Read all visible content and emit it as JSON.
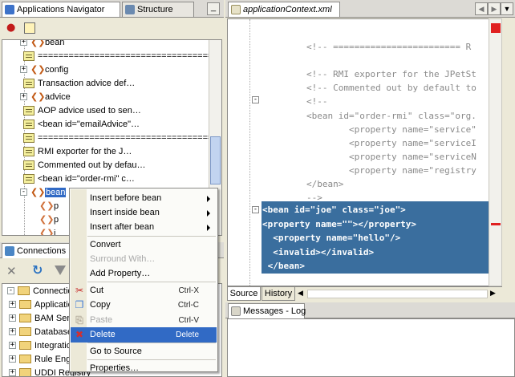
{
  "navigator": {
    "tab_applications": "Applications Navigator",
    "tab_structure": "Structure",
    "minimize": "_",
    "tree": [
      {
        "kind": "bean",
        "label": "bean",
        "expander": "+"
      },
      {
        "kind": "note",
        "label": "=====================================",
        "expander": ""
      },
      {
        "kind": "bean",
        "label": "config",
        "expander": "+"
      },
      {
        "kind": "note",
        "label": "Transaction advice def…",
        "expander": ""
      },
      {
        "kind": "bean",
        "label": "advice",
        "expander": "+"
      },
      {
        "kind": "note",
        "label": "AOP advice used to sen…",
        "expander": ""
      },
      {
        "kind": "note",
        "label": "<bean id=\"emailAdvice\"…",
        "expander": ""
      },
      {
        "kind": "note",
        "label": "=====================================",
        "expander": ""
      },
      {
        "kind": "note",
        "label": "RMI exporter for the J…",
        "expander": ""
      },
      {
        "kind": "note",
        "label": "Commented out by defau…",
        "expander": ""
      },
      {
        "kind": "note",
        "label": "<bean id=\"order-rmi\" c…",
        "expander": ""
      },
      {
        "kind": "bean",
        "label": "bean",
        "expander": "-",
        "selected": true
      },
      {
        "kind": "child",
        "label": "p",
        "expander": ""
      },
      {
        "kind": "child",
        "label": "p",
        "expander": ""
      },
      {
        "kind": "child",
        "label": "i",
        "expander": ""
      }
    ]
  },
  "connections": {
    "title": "Connections N",
    "tree": [
      {
        "label": "Connections",
        "expander": "-"
      },
      {
        "label": "Applicatio",
        "expander": "+"
      },
      {
        "label": "BAM Serv",
        "expander": "+"
      },
      {
        "label": "Database",
        "expander": "+"
      },
      {
        "label": "Integratio",
        "expander": "+"
      },
      {
        "label": "Rule Eng",
        "expander": "+"
      },
      {
        "label": "UDDI Registry",
        "expander": "+"
      }
    ]
  },
  "context_menu": {
    "items": [
      {
        "label": "Insert before bean",
        "submenu": true
      },
      {
        "label": "Insert inside bean",
        "submenu": true
      },
      {
        "label": "Insert after bean",
        "submenu": true
      },
      {
        "sep": true
      },
      {
        "label": "Convert"
      },
      {
        "label": "Surround With…",
        "disabled": true
      },
      {
        "label": "Add Property…"
      },
      {
        "sep": true
      },
      {
        "label": "Cut",
        "shortcut": "Ctrl-X",
        "icon": "scissors"
      },
      {
        "label": "Copy",
        "shortcut": "Ctrl-C",
        "icon": "copy"
      },
      {
        "label": "Paste",
        "shortcut": "Ctrl-V",
        "disabled": true,
        "icon": "paste"
      },
      {
        "label": "Delete",
        "shortcut": "Delete",
        "selected": true,
        "icon": "delete"
      },
      {
        "sep": true
      },
      {
        "label": "Go to Source"
      },
      {
        "sep": true
      },
      {
        "label": "Properties…"
      }
    ]
  },
  "editor": {
    "tab_label": "applicationContext.xml",
    "code_lines": [
      "<!-- ======================== R",
      "",
      "<!-- RMI exporter for the JPetSt",
      "<!-- Commented out by default to",
      "<!--",
      "<bean id=\"order-rmi\" class=\"org.",
      "        <property name=\"service\"",
      "        <property name=\"serviceI",
      "        <property name=\"serviceN",
      "        <property name=\"registry",
      "</bean>",
      "-->"
    ],
    "selected_lines": [
      "<bean id=\"joe\" class=\"joe\">",
      "<property name=\"\"></property>",
      "  <property name=\"hello\"/>",
      "  <invalid></invalid>",
      " </bean>"
    ],
    "bottom_tabs": [
      "Source",
      "History"
    ]
  },
  "log": {
    "tab_label": "Messages - Log"
  },
  "colors": {
    "selection": "#3a6e9e",
    "menu_highlight": "#316ac5",
    "error_marker": "#e02020"
  }
}
